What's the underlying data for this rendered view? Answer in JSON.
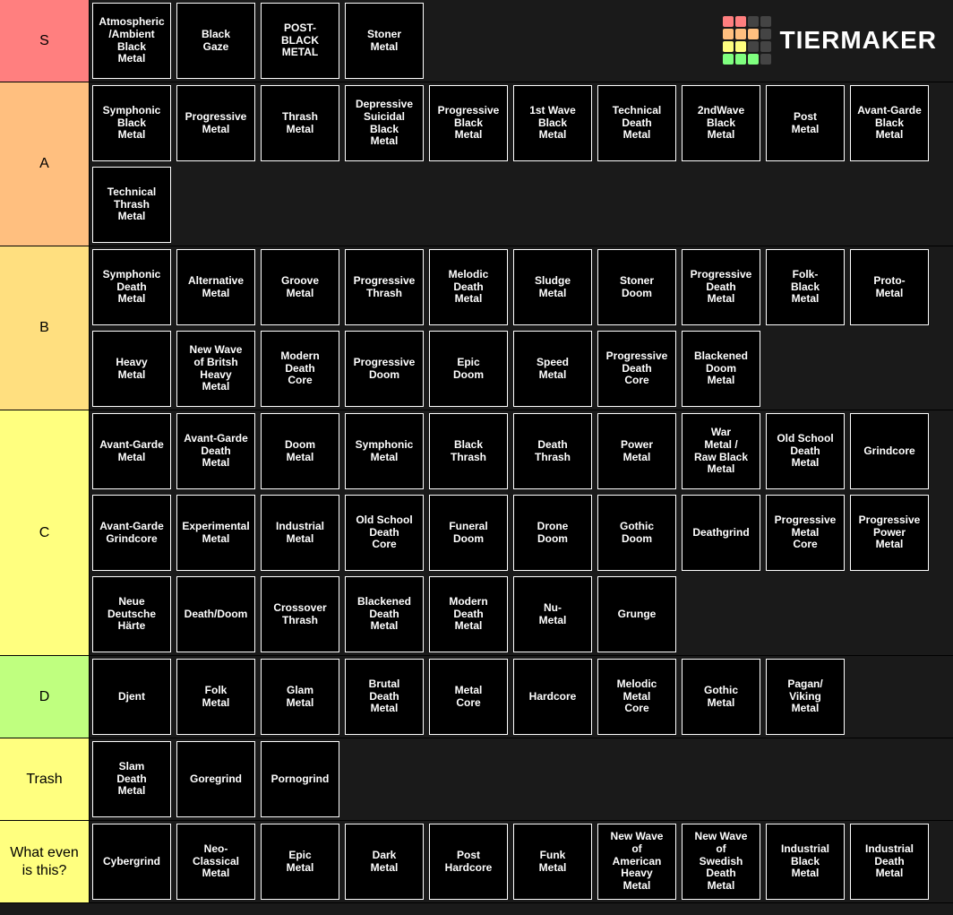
{
  "brand": "TierMaker",
  "logo_colors": {
    "red": "#ff7f7f",
    "orange": "#ffbf7f",
    "orange2": "#ffdf7f",
    "yellow": "#ffff7f",
    "green": "#bfff7f",
    "green2": "#7fff7f",
    "grey": "#444444"
  },
  "tiers": [
    {
      "label": "S",
      "color": "#ff7f7f",
      "items": [
        "Atmospheric\n/Ambient\nBlack\nMetal",
        "Black\nGaze",
        "POST-\nBLACK\nMETAL",
        "Stoner\nMetal"
      ]
    },
    {
      "label": "A",
      "color": "#ffbf7f",
      "items": [
        "Symphonic\nBlack\nMetal",
        "Progressive\nMetal",
        "Thrash\nMetal",
        "Depressive\nSuicidal\nBlack\nMetal",
        "Progressive\nBlack\nMetal",
        "1st Wave\nBlack\nMetal",
        "Technical\nDeath\nMetal",
        "2ndWave\nBlack\nMetal",
        "Post\nMetal",
        "Avant-Garde\nBlack\nMetal",
        "Technical\nThrash\nMetal"
      ]
    },
    {
      "label": "B",
      "color": "#ffdf7f",
      "items": [
        "Symphonic\nDeath\nMetal",
        "Alternative\nMetal",
        "Groove\nMetal",
        "Progressive\nThrash",
        "Melodic\nDeath\nMetal",
        "Sludge\nMetal",
        "Stoner\nDoom",
        "Progressive\nDeath\nMetal",
        "Folk-\nBlack\nMetal",
        "Proto-\nMetal",
        "Heavy\nMetal",
        "New Wave\nof Britsh\nHeavy\nMetal",
        "Modern\nDeath\nCore",
        "Progressive\nDoom",
        "Epic\nDoom",
        "Speed\nMetal",
        "Progressive\nDeath\nCore",
        "Blackened\nDoom\nMetal"
      ]
    },
    {
      "label": "C",
      "color": "#ffff7f",
      "items": [
        "Avant-Garde\nMetal",
        "Avant-Garde\nDeath\nMetal",
        "Doom\nMetal",
        "Symphonic\nMetal",
        "Black\nThrash",
        "Death\nThrash",
        "Power\nMetal",
        "War\nMetal /\nRaw Black\nMetal",
        "Old School\nDeath\nMetal",
        "Grindcore",
        "Avant-Garde\nGrindcore",
        "Experimental\nMetal",
        "Industrial\nMetal",
        "Old School\nDeath\nCore",
        "Funeral\nDoom",
        "Drone\nDoom",
        "Gothic\nDoom",
        "Deathgrind",
        "Progressive\nMetal\nCore",
        "Progressive\nPower\nMetal",
        "Neue\nDeutsche\nHärte",
        "Death/Doom",
        "Crossover\nThrash",
        "Blackened\nDeath\nMetal",
        "Modern\nDeath\nMetal",
        "Nu-\nMetal",
        "Grunge"
      ]
    },
    {
      "label": "D",
      "color": "#bfff7f",
      "items": [
        "Djent",
        "Folk\nMetal",
        "Glam\nMetal",
        "Brutal\nDeath\nMetal",
        "Metal\nCore",
        "Hardcore",
        "Melodic\nMetal\nCore",
        "Gothic\nMetal",
        "Pagan/\nViking\nMetal"
      ]
    },
    {
      "label": "Trash",
      "color": "#ffff7f",
      "items": [
        "Slam\nDeath\nMetal",
        "Goregrind",
        "Pornogrind"
      ]
    },
    {
      "label": "What even is this?",
      "color": "#ffff7f",
      "items": [
        "Cybergrind",
        "Neo-\nClassical\nMetal",
        "Epic\nMetal",
        "Dark\nMetal",
        "Post\nHardcore",
        "Funk\nMetal",
        "New Wave\nof\nAmerican\nHeavy\nMetal",
        "New Wave\nof\nSwedish\nDeath\nMetal",
        "Industrial\nBlack\nMetal",
        "Industrial\nDeath\nMetal"
      ]
    }
  ]
}
